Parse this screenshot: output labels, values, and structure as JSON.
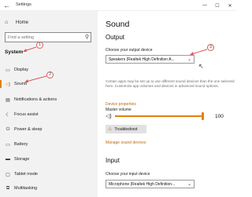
{
  "window": {
    "title": "Settings",
    "back_icon": "←",
    "minimize": "—",
    "maximize": "☐",
    "close": "✕"
  },
  "sidebar": {
    "home_icon": "⌂",
    "home_label": "Home",
    "search_placeholder": "Find a setting",
    "search_icon": "⚲",
    "section_title": "System",
    "items": [
      {
        "label": "Display",
        "icon": "▭"
      },
      {
        "label": "Sound",
        "icon": "◁)"
      },
      {
        "label": "Notifications & actions",
        "icon": "▤"
      },
      {
        "label": "Focus assist",
        "icon": "☾"
      },
      {
        "label": "Power & sleep",
        "icon": "⏻"
      },
      {
        "label": "Battery",
        "icon": "▭"
      },
      {
        "label": "Storage",
        "icon": "▬"
      },
      {
        "label": "Tablet mode",
        "icon": "▢"
      },
      {
        "label": "Multitasking",
        "icon": "⧉"
      }
    ]
  },
  "main": {
    "page_title": "Sound",
    "output": {
      "heading": "Output",
      "device_label": "Choose your output device",
      "device_value": "Speakers (Realtek High Definition A...",
      "chevron": "⌄",
      "description": "Certain apps may be set up to use different sound devices than the one selected here. Customize app volumes and devices in advanced sound options.",
      "device_properties_link": "Device properties",
      "master_volume_label": "Master volume",
      "volume_icon": "◁)",
      "volume_value": "100",
      "volume_level": 1.0,
      "troubleshoot_icon": "⚠",
      "troubleshoot_label": "Troubleshoot",
      "manage_link": "Manage sound devices"
    },
    "input": {
      "heading": "Input",
      "device_label": "Choose your input device",
      "device_value": "Microphone (Realtek High Definition...",
      "chevron": "⌄"
    }
  },
  "annotations": {
    "marker_1": "1",
    "marker_2": "2",
    "marker_3": "3",
    "arrow_color": "#d9585e"
  },
  "colors": {
    "accent": "#e2810d",
    "link": "#c26a0b",
    "sidebar_bg": "#f2f2f2"
  }
}
